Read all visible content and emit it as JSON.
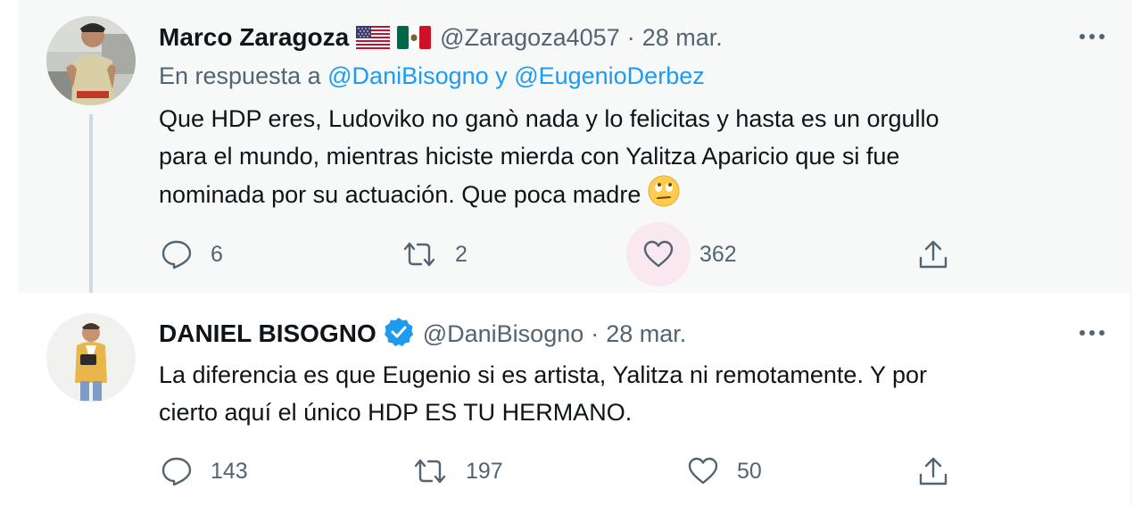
{
  "tweets": [
    {
      "name": "Marco Zaragoza",
      "flags": [
        "us-flag",
        "mx-flag"
      ],
      "handle": "@Zaragoza4057",
      "separator": "·",
      "date": "28 mar.",
      "replying_prefix": "En respuesta a",
      "replying_user1": "@DaniBisogno",
      "replying_joiner": "y",
      "replying_user2": "@EugenioDerbez",
      "text_lines": [
        "Que HDP eres, Ludoviko no ganò nada y lo felicitas y hasta es un orgullo",
        "para el mundo, mientras hiciste mierda con Yalitza Aparicio que si fue",
        "nominada por su actuación. Que poca madre"
      ],
      "emoji": "eye-roll-emoji",
      "replies": "6",
      "retweets": "2",
      "likes": "362"
    },
    {
      "name": "DANIEL BISOGNO",
      "verified": true,
      "handle": "@DaniBisogno",
      "separator": "·",
      "date": "28 mar.",
      "text_lines": [
        "La diferencia es que Eugenio si es artista, Yalitza ni remotamente. Y por",
        "cierto aquí el único HDP ES TU HERMANO."
      ],
      "replies": "143",
      "retweets": "197",
      "likes": "50"
    }
  ],
  "colors": {
    "text": "#0f1419",
    "secondary": "#536471",
    "link": "#1d9bf0",
    "verified": "#1d9bf0",
    "like_highlight": "#f9e8f0",
    "thread_line": "#cfd9de"
  }
}
